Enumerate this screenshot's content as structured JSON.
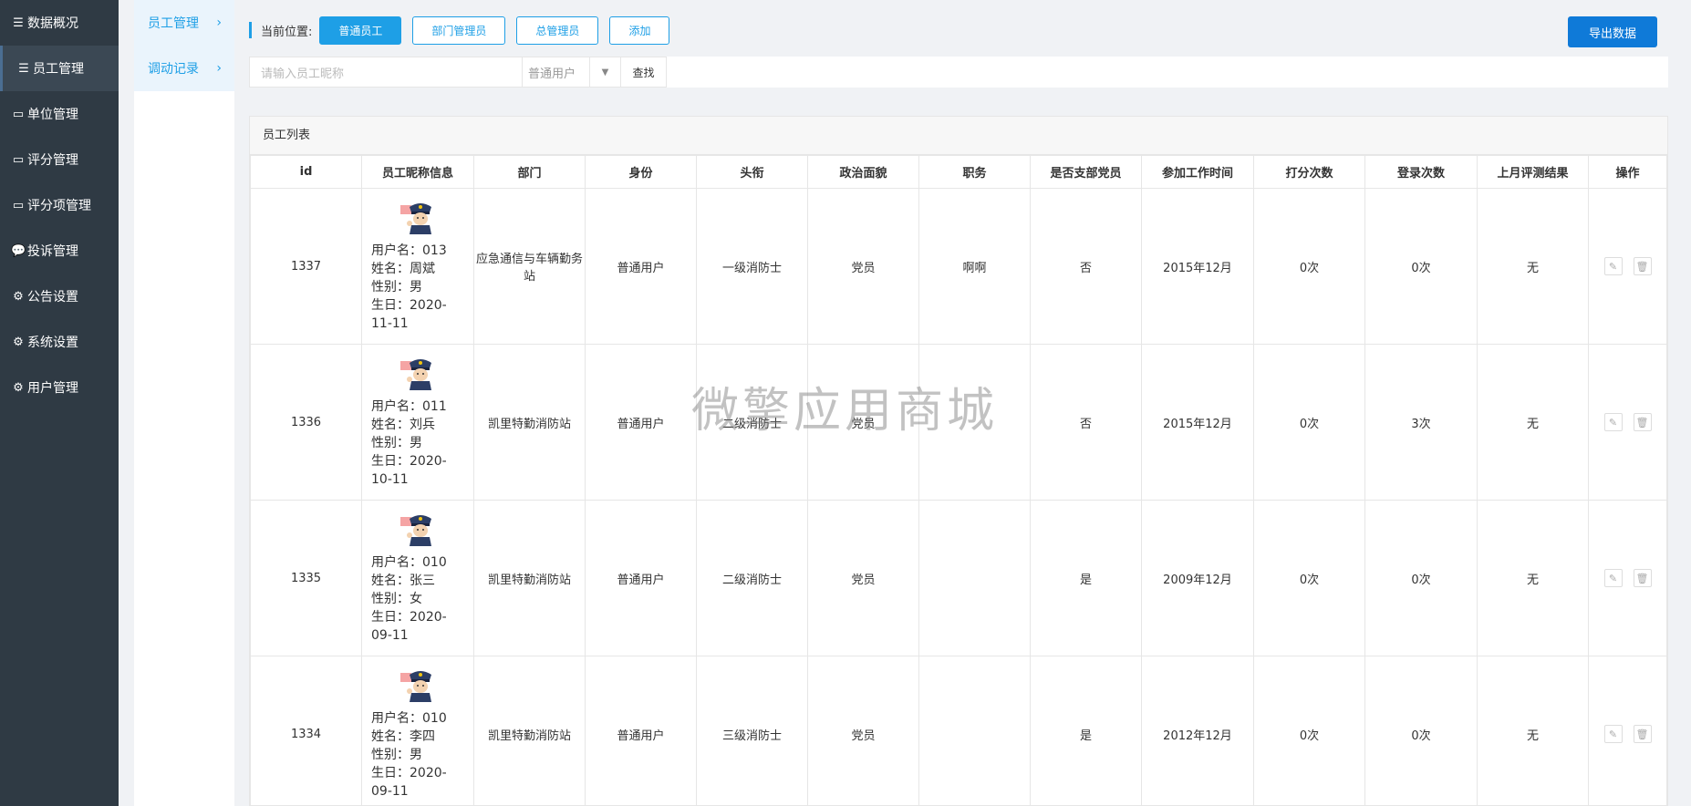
{
  "sidebar": {
    "items": [
      {
        "icon": "menu-lines-icon",
        "label": "数据概况",
        "active": false
      },
      {
        "icon": "menu-lines-icon",
        "label": "员工管理",
        "active": true
      },
      {
        "icon": "id-card-icon",
        "label": "单位管理",
        "active": false
      },
      {
        "icon": "id-card-icon",
        "label": "评分管理",
        "active": false
      },
      {
        "icon": "id-card-icon",
        "label": "评分项管理",
        "active": false
      },
      {
        "icon": "chat-bubble-icon",
        "label": "投诉管理",
        "active": false
      },
      {
        "icon": "gear-icon",
        "label": "公告设置",
        "active": false
      },
      {
        "icon": "gear-icon",
        "label": "系统设置",
        "active": false
      },
      {
        "icon": "gear-icon",
        "label": "用户管理",
        "active": false
      }
    ]
  },
  "submenu": {
    "items": [
      {
        "label": "员工管理",
        "chevron": "›"
      },
      {
        "label": "调动记录",
        "chevron": "›"
      }
    ]
  },
  "breadcrumb": {
    "label": "当前位置:",
    "tabs": [
      "普通员工",
      "部门管理员",
      "总管理员",
      "添加"
    ],
    "active_tab": "普通员工"
  },
  "export_button": "导出数据",
  "search": {
    "placeholder": "请输入员工昵称",
    "select_value": "普通用户",
    "button": "查找"
  },
  "panel": {
    "title": "员工列表",
    "columns": [
      "id",
      "员工昵称信息",
      "部门",
      "身份",
      "头衔",
      "政治面貌",
      "职务",
      "是否支部党员",
      "参加工作时间",
      "打分次数",
      "登录次数",
      "上月评测结果",
      "操作"
    ],
    "rows": [
      {
        "id": "1337",
        "info": [
          "用户名：013",
          "姓名：周斌",
          "性别：男",
          "生日：2020-11-11"
        ],
        "dept": "应急通信与车辆勤务站",
        "role": "普通用户",
        "title": "一级消防士",
        "political": "党员",
        "duty": "啊啊",
        "party_member": "否",
        "work_time": "2015年12月",
        "score_count": "0次",
        "login_count": "0次",
        "last_result": "无"
      },
      {
        "id": "1336",
        "info": [
          "用户名：011",
          "姓名：刘兵",
          "性别：男",
          "生日：2020-10-11"
        ],
        "dept": "凯里特勤消防站",
        "role": "普通用户",
        "title": "二级消防士",
        "political": "党员",
        "duty": "",
        "party_member": "否",
        "work_time": "2015年12月",
        "score_count": "0次",
        "login_count": "3次",
        "last_result": "无"
      },
      {
        "id": "1335",
        "info": [
          "用户名：010",
          "姓名：张三",
          "性别：女",
          "生日：2020-09-11"
        ],
        "dept": "凯里特勤消防站",
        "role": "普通用户",
        "title": "二级消防士",
        "political": "党员",
        "duty": "",
        "party_member": "是",
        "work_time": "2009年12月",
        "score_count": "0次",
        "login_count": "0次",
        "last_result": "无"
      },
      {
        "id": "1334",
        "info": [
          "用户名：010",
          "姓名：李四",
          "性别：男",
          "生日：2020-09-11"
        ],
        "dept": "凯里特勤消防站",
        "role": "普通用户",
        "title": "三级消防士",
        "political": "党员",
        "duty": "",
        "party_member": "是",
        "work_time": "2012年12月",
        "score_count": "0次",
        "login_count": "0次",
        "last_result": "无"
      }
    ]
  },
  "watermark": "微擎应用商城",
  "colors": {
    "sidebar_bg": "#2f3a44",
    "accent": "#1e9fe6",
    "export": "#0f7ad8"
  }
}
